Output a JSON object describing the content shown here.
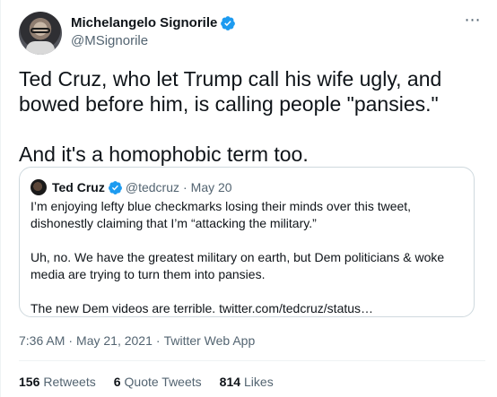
{
  "author": {
    "display_name": "Michelangelo Signorile",
    "handle": "@MSignorile",
    "verified": true
  },
  "more_icon": "⋯",
  "tweet": {
    "text": "Ted Cruz, who let Trump call his wife ugly, and bowed before him, is calling people \"pansies.\"\n\nAnd it's a homophobic term too."
  },
  "quote": {
    "display_name": "Ted Cruz",
    "handle": "@tedcruz",
    "separator": "·",
    "date": "May 20",
    "verified": true,
    "paragraphs": [
      "I’m enjoying lefty blue checkmarks losing their minds over this tweet, dishonestly claiming that I’m “attacking the military.”",
      "Uh, no. We have the greatest military on earth, but Dem politicians & woke media are trying to turn them into pansies.",
      "The new Dem videos are terrible. twitter.com/tedcruz/status…"
    ]
  },
  "meta": {
    "time": "7:36 AM",
    "separator": "·",
    "date": "May 21, 2021",
    "source": "Twitter Web App"
  },
  "stats": {
    "retweets": {
      "count": "156",
      "label": "Retweets"
    },
    "quote_tweets": {
      "count": "6",
      "label": "Quote Tweets"
    },
    "likes": {
      "count": "814",
      "label": "Likes"
    }
  },
  "colors": {
    "verified_blue": "#1d9bf0",
    "secondary_text": "#536471",
    "border": "#cfd9de"
  }
}
